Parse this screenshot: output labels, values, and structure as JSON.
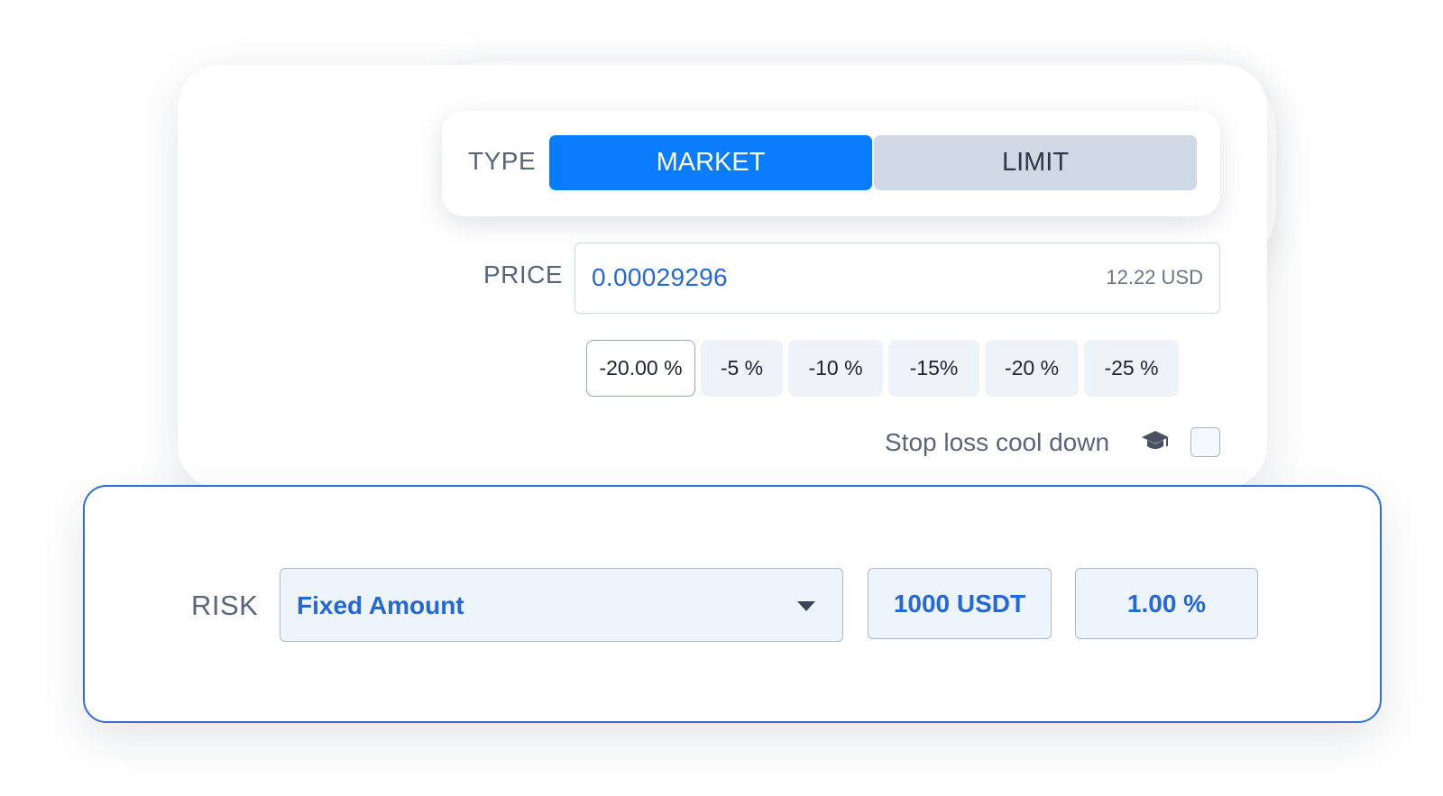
{
  "order_type": {
    "label": "TYPE",
    "options": [
      "MARKET",
      "LIMIT"
    ],
    "selected": "MARKET",
    "active_color": "#0a7cff",
    "inactive_color": "#d0d8e3"
  },
  "price": {
    "label": "PRICE",
    "value": "0.00029296",
    "usd_equivalent": "12.22 USD",
    "value_color": "#2467d8"
  },
  "percent_options": [
    "-20.00 %",
    "-5 %",
    "-10 %",
    "-15%",
    "-20 %",
    "-25 %"
  ],
  "stop_loss": {
    "label": "Stop loss cool down",
    "icon": "graduation-cap-icon",
    "checked": false
  },
  "risk": {
    "label": "RISK",
    "mode": "Fixed Amount",
    "amount": "1000 USDT",
    "percent": "1.00 %",
    "border_color": "#2f6fd6"
  }
}
